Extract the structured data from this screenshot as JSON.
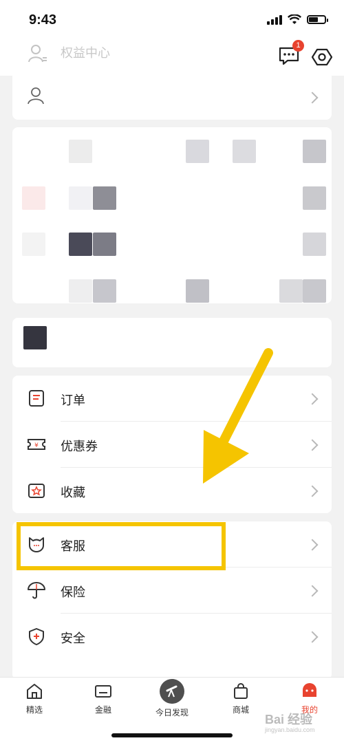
{
  "status_bar": {
    "time": "9:43"
  },
  "top_bar": {
    "title": "权益中心",
    "message_badge": "1"
  },
  "menu_group_1": [
    {
      "label": "订单",
      "icon": "order-icon"
    },
    {
      "label": "优惠券",
      "icon": "coupon-icon"
    },
    {
      "label": "收藏",
      "icon": "favorite-icon"
    }
  ],
  "menu_group_2": [
    {
      "label": "客服",
      "icon": "customer-service-icon"
    },
    {
      "label": "保险",
      "icon": "umbrella-icon"
    },
    {
      "label": "安全",
      "icon": "shield-icon"
    }
  ],
  "tabs": [
    {
      "label": "精选",
      "icon": "home-icon"
    },
    {
      "label": "金融",
      "icon": "card-icon"
    },
    {
      "label": "今日发现",
      "icon": "telescope-icon"
    },
    {
      "label": "商城",
      "icon": "bag-icon"
    },
    {
      "label": "我的",
      "icon": "profile-icon",
      "active": true
    }
  ],
  "watermark": {
    "text": "Bai 经验",
    "sub": "jingyan.baidu.com"
  },
  "colors": {
    "accent": "#e8432f",
    "highlight": "#f5c400"
  }
}
